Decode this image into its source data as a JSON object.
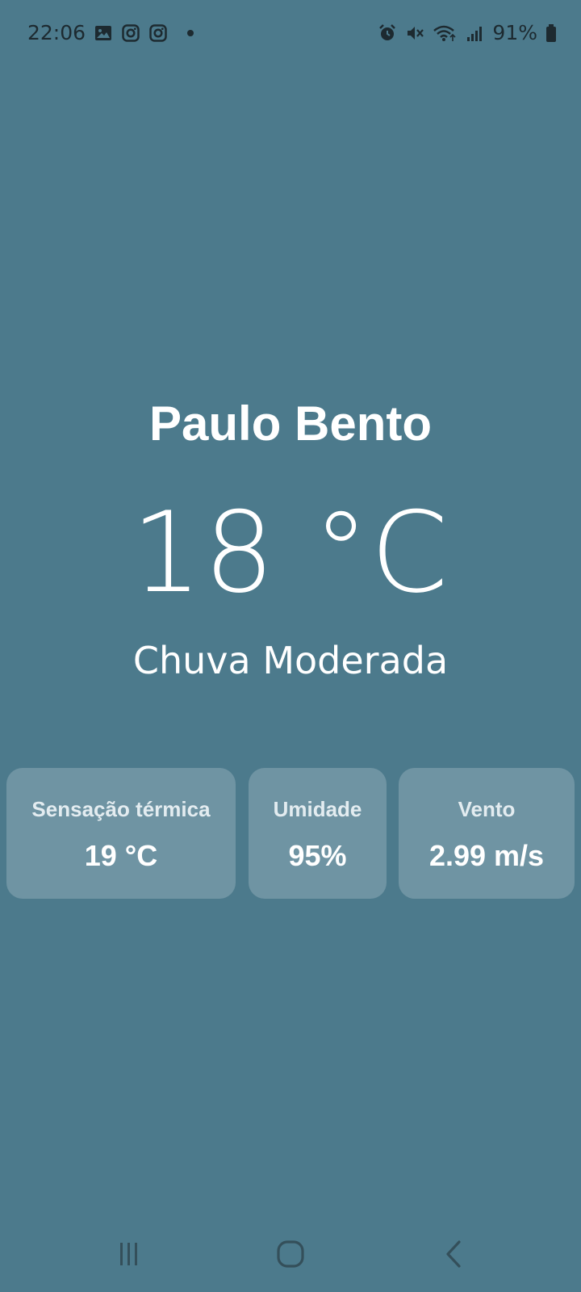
{
  "status_bar": {
    "time": "22:06",
    "battery_percent": "91%",
    "left_icons": [
      "gallery-icon",
      "instagram-icon",
      "instagram-icon",
      "notification-dot"
    ],
    "right_icons": [
      "alarm-icon",
      "mute-icon",
      "wifi-icon",
      "signal-icon",
      "battery-icon"
    ]
  },
  "weather": {
    "city": "Paulo Bento",
    "temperature": "18 °C",
    "condition": "Chuva Moderada"
  },
  "cards": {
    "feels_like": {
      "title": "Sensação térmica",
      "value": "19 °C"
    },
    "humidity": {
      "title": "Umidade",
      "value": "95%"
    },
    "wind": {
      "title": "Vento",
      "value": "2.99 m/s"
    }
  },
  "nav_bar": {
    "buttons": [
      "recents-icon",
      "home-icon",
      "back-icon"
    ]
  },
  "colors": {
    "background": "#4c7a8c",
    "card_background": "rgba(255,255,255,0.2)",
    "text": "#ffffff",
    "status_text": "#1d2a30"
  }
}
